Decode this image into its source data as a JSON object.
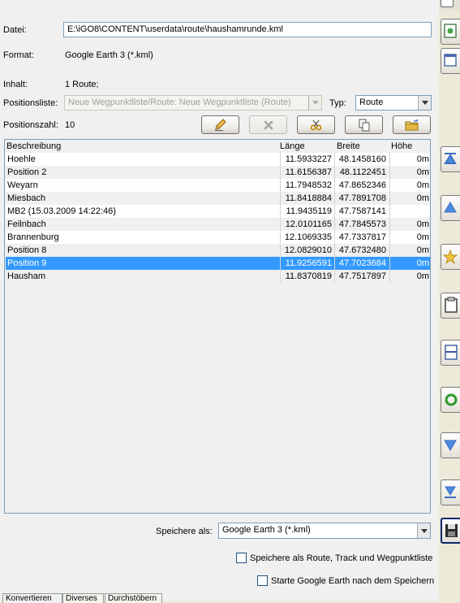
{
  "form": {
    "datei_label": "Datei:",
    "datei_value": "E:\\iGO8\\CONTENT\\userdata\\route\\haushamrunde.kml",
    "format_label": "Format:",
    "format_value": "Google Earth 3 (*.kml)",
    "inhalt_label": "Inhalt:",
    "inhalt_value": "1 Route;",
    "positionsliste_label": "Positionsliste:",
    "positionsliste_value": "Neue Wegpunktliste/Route: Neue Wegpunktliste (Route)",
    "typ_label": "Typ:",
    "typ_value": "Route",
    "positionszahl_label": "Positionszahl:",
    "positionszahl_value": "10"
  },
  "toolbar": {
    "icons": [
      "pencil-icon",
      "delete-x-icon",
      "scissors-icon",
      "copy-icon",
      "paste-folder-icon"
    ]
  },
  "table": {
    "headers": [
      "Beschreibung",
      "Länge",
      "Breite",
      "Höhe"
    ],
    "rows": [
      {
        "name": "Hoehle",
        "laenge": "11.5933227",
        "breite": "48.1458160",
        "hoehe": "0m"
      },
      {
        "name": "Position 2",
        "laenge": "11.6156387",
        "breite": "48.1122451",
        "hoehe": "0m"
      },
      {
        "name": "Weyarn",
        "laenge": "11.7948532",
        "breite": "47.8652346",
        "hoehe": "0m"
      },
      {
        "name": "Miesbach",
        "laenge": "11.8418884",
        "breite": "47.7891708",
        "hoehe": "0m"
      },
      {
        "name": "MB2 (15.03.2009 14:22:46)",
        "laenge": "11.9435119",
        "breite": "47.7587141",
        "hoehe": ""
      },
      {
        "name": "Feilnbach",
        "laenge": "12.0101165",
        "breite": "47.7845573",
        "hoehe": "0m"
      },
      {
        "name": "Brannenburg",
        "laenge": "12.1069335",
        "breite": "47.7337817",
        "hoehe": "0m"
      },
      {
        "name": "Position 8",
        "laenge": "12.0829010",
        "breite": "47.6732480",
        "hoehe": "0m"
      },
      {
        "name": "Position 9",
        "laenge": "11.9256591",
        "breite": "47.7023684",
        "hoehe": "0m"
      },
      {
        "name": "Hausham",
        "laenge": "11.8370819",
        "breite": "47.7517897",
        "hoehe": "0m"
      }
    ],
    "selected_index": 8
  },
  "save": {
    "label": "Speichere als:",
    "value": "Google Earth 3 (*.kml)",
    "option1_label": "Speichere als Route, Track und Wegpunktliste",
    "option2_label": "Starte Google Earth nach dem Speichern"
  },
  "tabs": [
    "Konvertieren",
    "Diverses",
    "Durchstöbern"
  ],
  "colors": {
    "selection": "#3399FF",
    "panel": "#F0F0F0",
    "border": "#7F9DB9"
  }
}
